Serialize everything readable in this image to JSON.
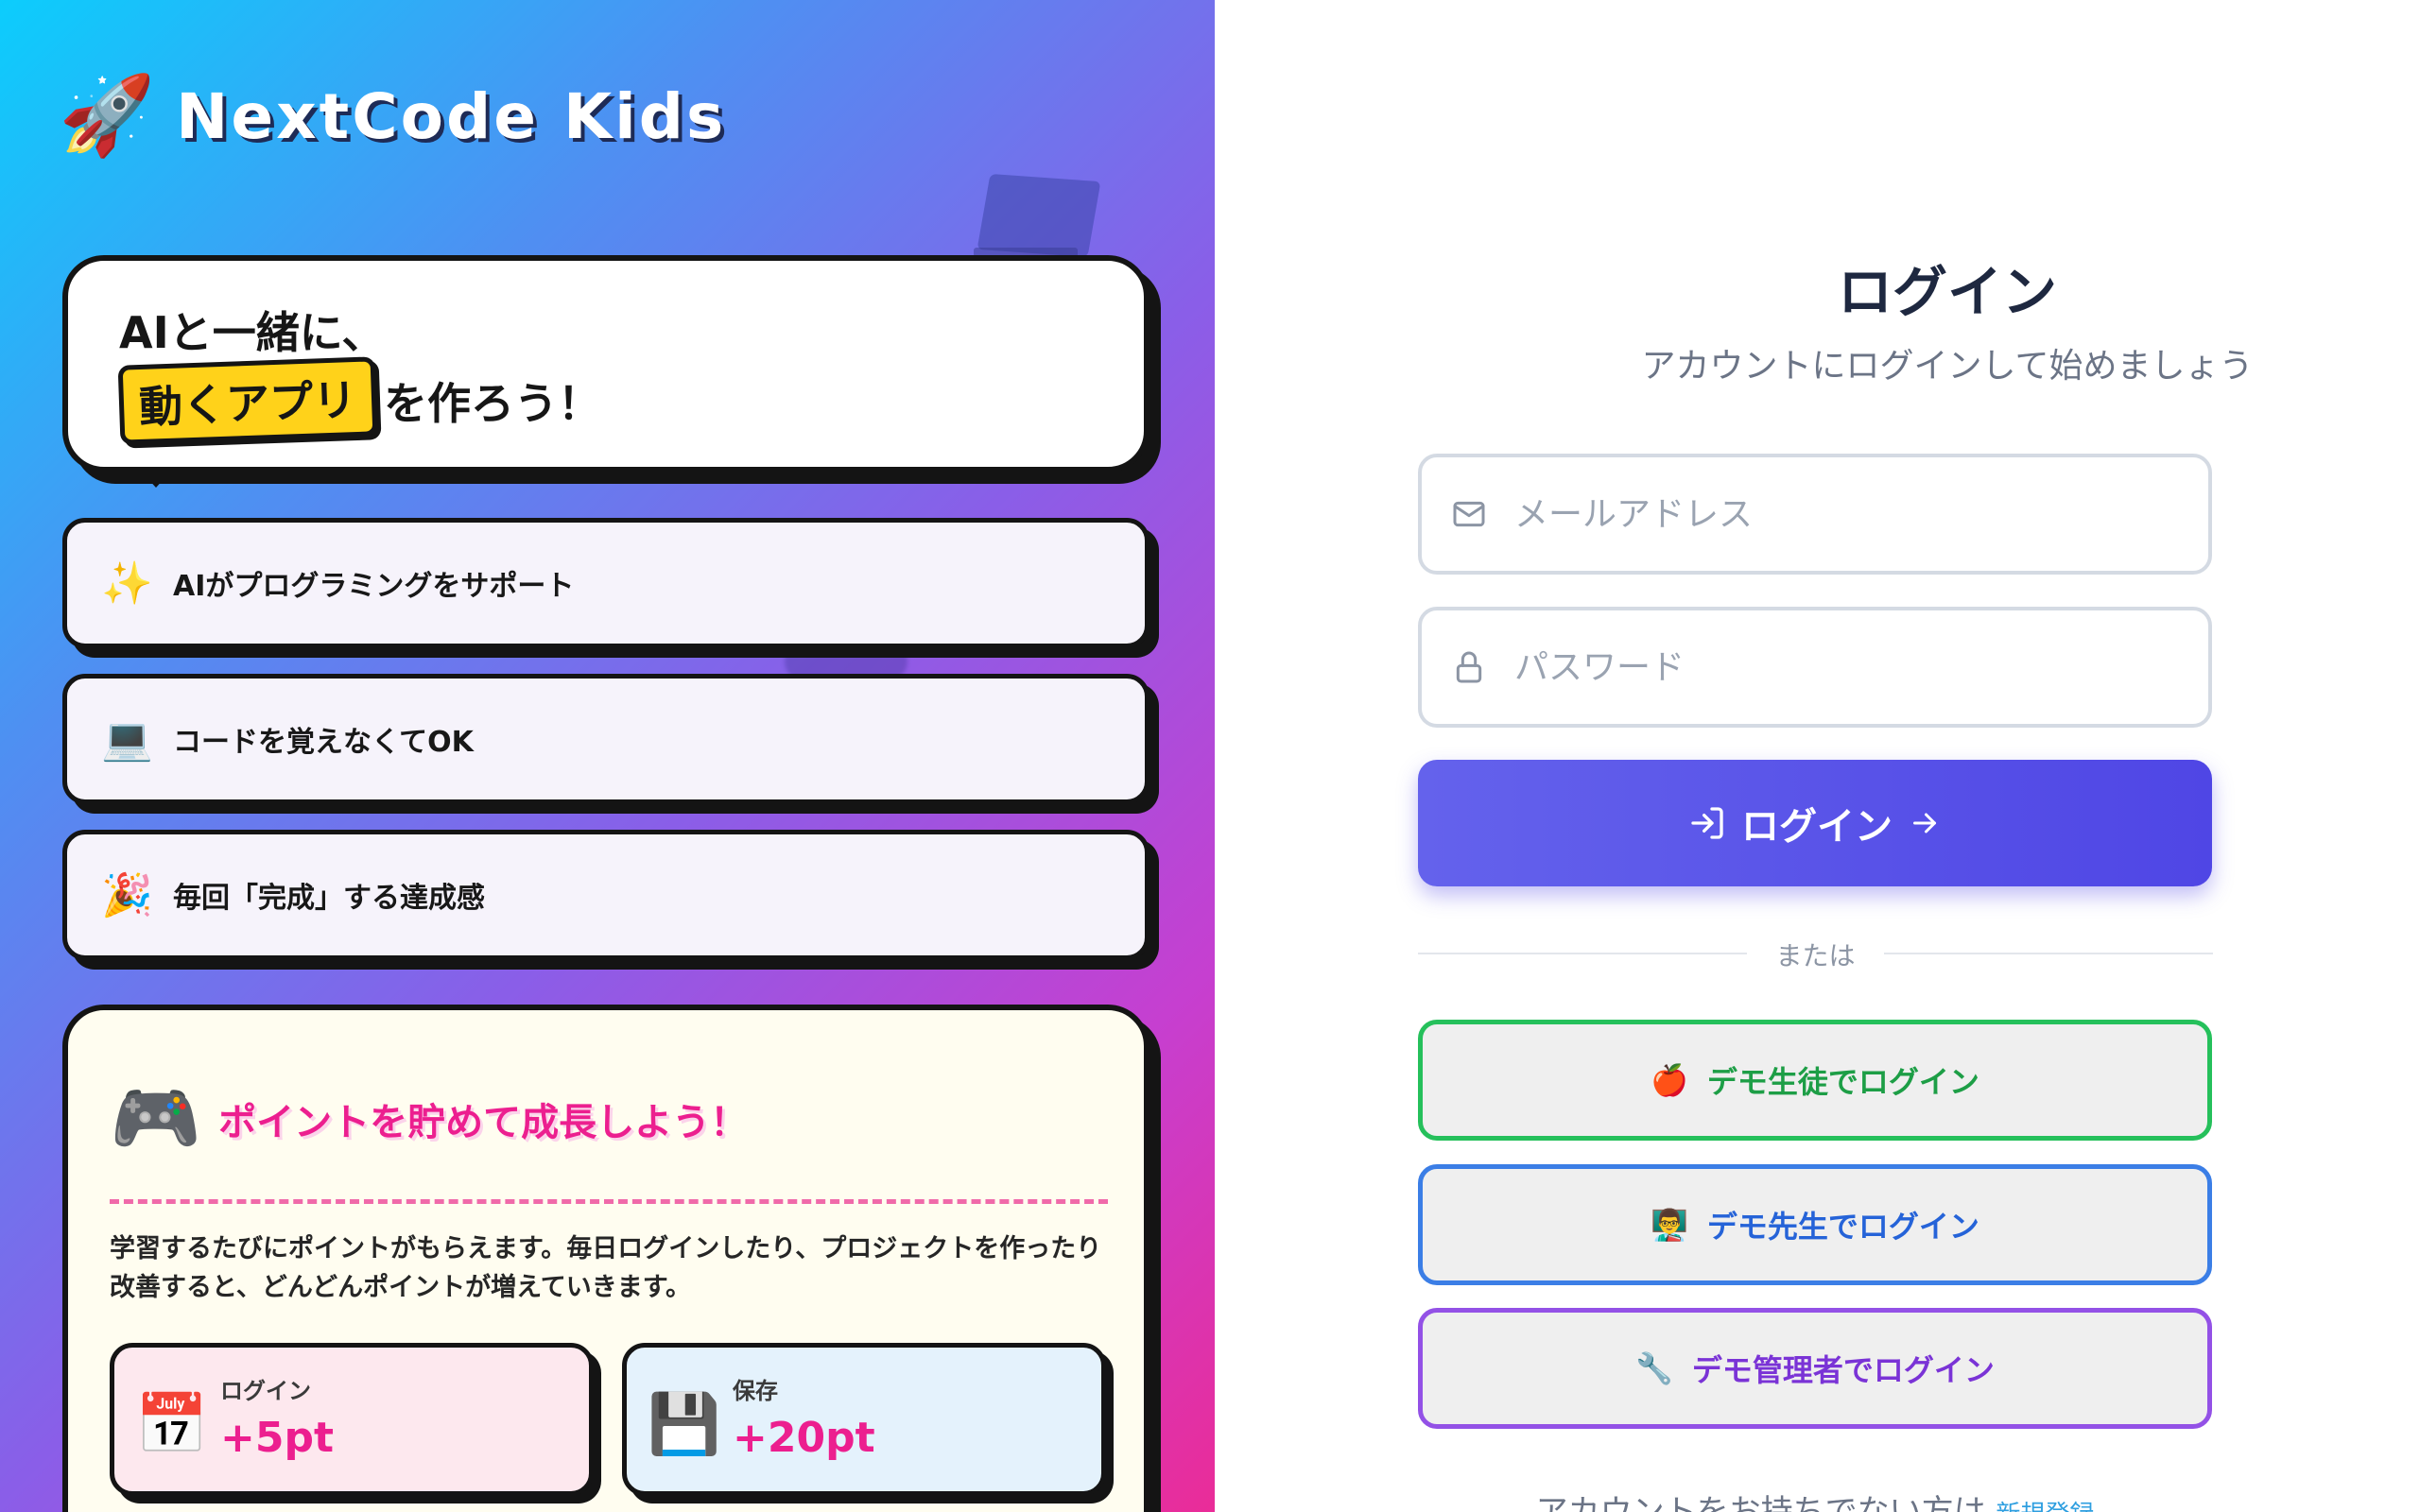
{
  "brand": {
    "icon": "🚀",
    "name": "NextCode Kids"
  },
  "hero": {
    "line1": "AIと一緒に、",
    "highlight": "動くアプリ",
    "line2_rest": "を作ろう！"
  },
  "features": [
    {
      "icon": "✨",
      "label": "AIがプログラミングをサポート"
    },
    {
      "icon": "💻",
      "label": "コードを覚えなくてOK"
    },
    {
      "icon": "🎉",
      "label": "毎回「完成」する達成感"
    }
  ],
  "points": {
    "icon": "🎮",
    "title": "ポイントを貯めて成長しよう！",
    "description": "学習するたびにポイントがもらえます。毎日ログインしたり、プロジェクトを作ったり改善すると、どんどんポイントが増えていきます。",
    "items": [
      {
        "icon": "📅",
        "label": "ログイン",
        "value": "+5pt"
      },
      {
        "icon": "💾",
        "label": "保存",
        "value": "+20pt"
      }
    ]
  },
  "login": {
    "title": "ログイン",
    "subtitle": "アカウントにログインして始めましょう",
    "email_placeholder": "メールアドレス",
    "password_placeholder": "パスワード",
    "email_value": "",
    "password_value": "",
    "submit_label": "ログイン",
    "divider_text": "または",
    "demo_student": {
      "icon": "🍎",
      "label": "デモ生徒でログイン"
    },
    "demo_teacher": {
      "icon": "👨‍🏫",
      "label": "デモ先生でログイン"
    },
    "demo_admin": {
      "icon": "🔧",
      "label": "デモ管理者でログイン"
    },
    "footer_text": "アカウントをお持ちでない方は",
    "footer_link": "新規登録"
  },
  "colors": {
    "accent": "#4f46e5",
    "student": "#25c05b",
    "teacher": "#3b7ee6",
    "admin": "#9351e6",
    "highlight": "#ffd21a",
    "pink": "#ec1f8f"
  }
}
